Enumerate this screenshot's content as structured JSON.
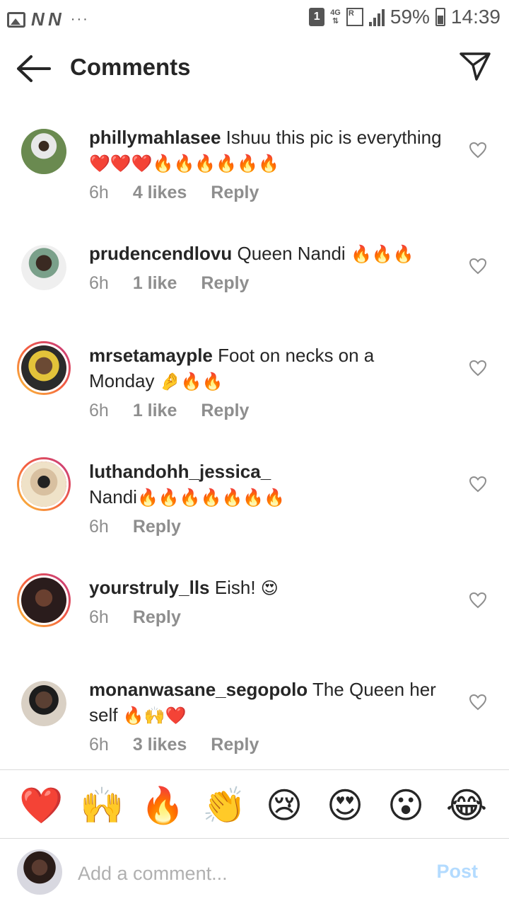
{
  "status_bar": {
    "left_letters": "N N",
    "more": "···",
    "sim": "1",
    "network": "4G",
    "roaming": "R",
    "battery_percent": "59%",
    "time": "14:39"
  },
  "header": {
    "title": "Comments",
    "back_icon": "arrow-left-icon",
    "share_icon": "paper-plane-icon"
  },
  "comments": [
    {
      "user": "phillymahlasee",
      "text": "Ishuu this pic is everything",
      "emojis": "❤️❤️❤️🔥🔥🔥🔥🔥🔥",
      "time": "6h",
      "likes": "4 likes",
      "reply": "Reply",
      "avatar_color": "#8aa06a"
    },
    {
      "user": "prudencendlovu",
      "text": "Queen Nandi",
      "emojis": "🔥🔥🔥",
      "time": "6h",
      "likes": "1 like",
      "reply": "Reply",
      "avatar_color": "#bfbfbf"
    },
    {
      "user": "mrsetamayple",
      "text": "Foot on necks on a Monday",
      "emojis": "🤌🔥🔥",
      "time": "6h",
      "likes": "1 like",
      "reply": "Reply",
      "avatar_color": "#3b3026"
    },
    {
      "user": "luthandohh_jessica_",
      "text": "Nandi",
      "emojis": "🔥🔥🔥🔥🔥🔥🔥",
      "time": "6h",
      "likes": "",
      "reply": "Reply",
      "avatar_color": "#c9b090"
    },
    {
      "user": "yourstruly_lls",
      "text": "Eish!",
      "emojis": "😍",
      "time": "6h",
      "likes": "",
      "reply": "Reply",
      "avatar_color": "#3a2a2a"
    },
    {
      "user": "monanwasane_segopolo",
      "text": "The Queen her self",
      "emojis": "🔥🙌❤️",
      "time": "6h",
      "likes": "3 likes",
      "reply": "Reply",
      "avatar_color": "#5a4033"
    }
  ],
  "reactions": [
    "❤️",
    "🙌",
    "🔥",
    "👏",
    "😢",
    "😍",
    "😮",
    "😂"
  ],
  "composer": {
    "placeholder": "Add a comment...",
    "post_label": "Post"
  }
}
